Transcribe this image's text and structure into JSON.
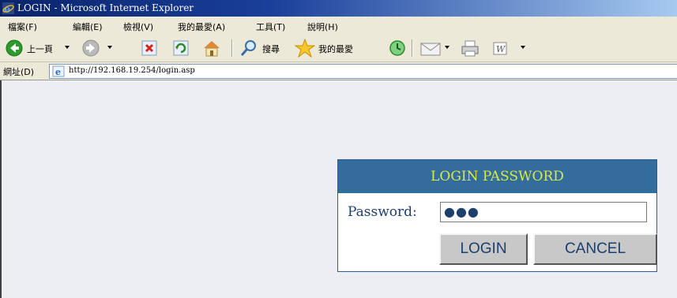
{
  "window": {
    "title": "LOGIN - Microsoft Internet Explorer",
    "app_icon": "ie-icon"
  },
  "menu": [
    "檔案(F)",
    "編輯(E)",
    "檢視(V)",
    "我的最愛(A)",
    "工具(T)",
    "說明(H)"
  ],
  "toolbar": {
    "back_label": "上一頁",
    "search_label": "搜尋",
    "favorites_label": "我的最愛",
    "icons": [
      "back-icon",
      "forward-icon",
      "stop-icon",
      "refresh-icon",
      "home-icon",
      "search-icon",
      "favorites-icon",
      "history-icon",
      "mail-icon",
      "print-icon",
      "edit-icon"
    ]
  },
  "address": {
    "label": "網址(D)",
    "url": "http://192.168.19.254/login.asp"
  },
  "login": {
    "title": "LOGIN PASSWORD",
    "password_label": "Password:",
    "password_value": "●●●",
    "login_button": "LOGIN",
    "cancel_button": "CANCEL"
  },
  "colors": {
    "header_bg": "#336d9e",
    "header_text": "#d9e84d",
    "label_text": "#1c3f6e",
    "page_bg": "#eceef3"
  }
}
